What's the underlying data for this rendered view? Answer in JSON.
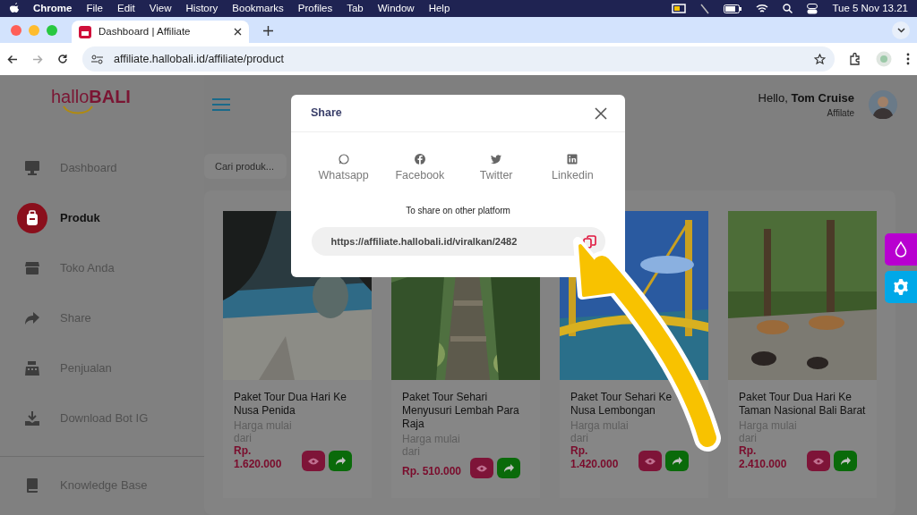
{
  "menubar": {
    "app": "Chrome",
    "menus": [
      "File",
      "Edit",
      "View",
      "History",
      "Bookmarks",
      "Profiles",
      "Tab",
      "Window",
      "Help"
    ],
    "clock": "Tue 5 Nov 13.21"
  },
  "browser": {
    "tab_title": "Dashboard | Affiliate",
    "url": "affiliate.hallobali.id/affiliate/product"
  },
  "logo": {
    "first": "hallo",
    "second": "BALI"
  },
  "sidebar": {
    "items": [
      {
        "label": "Dashboard",
        "selected": false
      },
      {
        "label": "Produk",
        "selected": true
      },
      {
        "label": "Toko Anda",
        "selected": false
      },
      {
        "label": "Share",
        "selected": false
      },
      {
        "label": "Penjualan",
        "selected": false
      },
      {
        "label": "Download Bot IG",
        "selected": false
      }
    ],
    "footer_items": [
      {
        "label": "Knowledge Base",
        "selected": false
      }
    ]
  },
  "header": {
    "greeting": "Hello,",
    "user_name": "Tom Cruise",
    "role": "Affilate"
  },
  "search": {
    "placeholder": "Cari produk..."
  },
  "products": [
    {
      "title": "Paket Tour Dua Hari Ke Nusa Penida",
      "price_label": "Harga mulai dari",
      "price": "Rp. 1.620.000"
    },
    {
      "title": "Paket Tour Sehari Menyusuri Lembah Para Raja",
      "price_label": "Harga mulai dari",
      "price": "Rp. 510.000"
    },
    {
      "title": "Paket Tour Sehari Ke Nusa Lembongan",
      "price_label": "Harga mulai dari",
      "price": "Rp. 1.420.000"
    },
    {
      "title": "Paket Tour Dua Hari Ke Taman Nasional Bali Barat",
      "price_label": "Harga mulai dari",
      "price": "Rp. 2.410.000"
    }
  ],
  "modal": {
    "title": "Share",
    "options": [
      {
        "label": "Whatsapp"
      },
      {
        "label": "Facebook"
      },
      {
        "label": "Twitter"
      },
      {
        "label": "Linkedin"
      }
    ],
    "hint": "To share on other platform",
    "link": "https://affiliate.hallobali.id/viralkan/2482"
  }
}
